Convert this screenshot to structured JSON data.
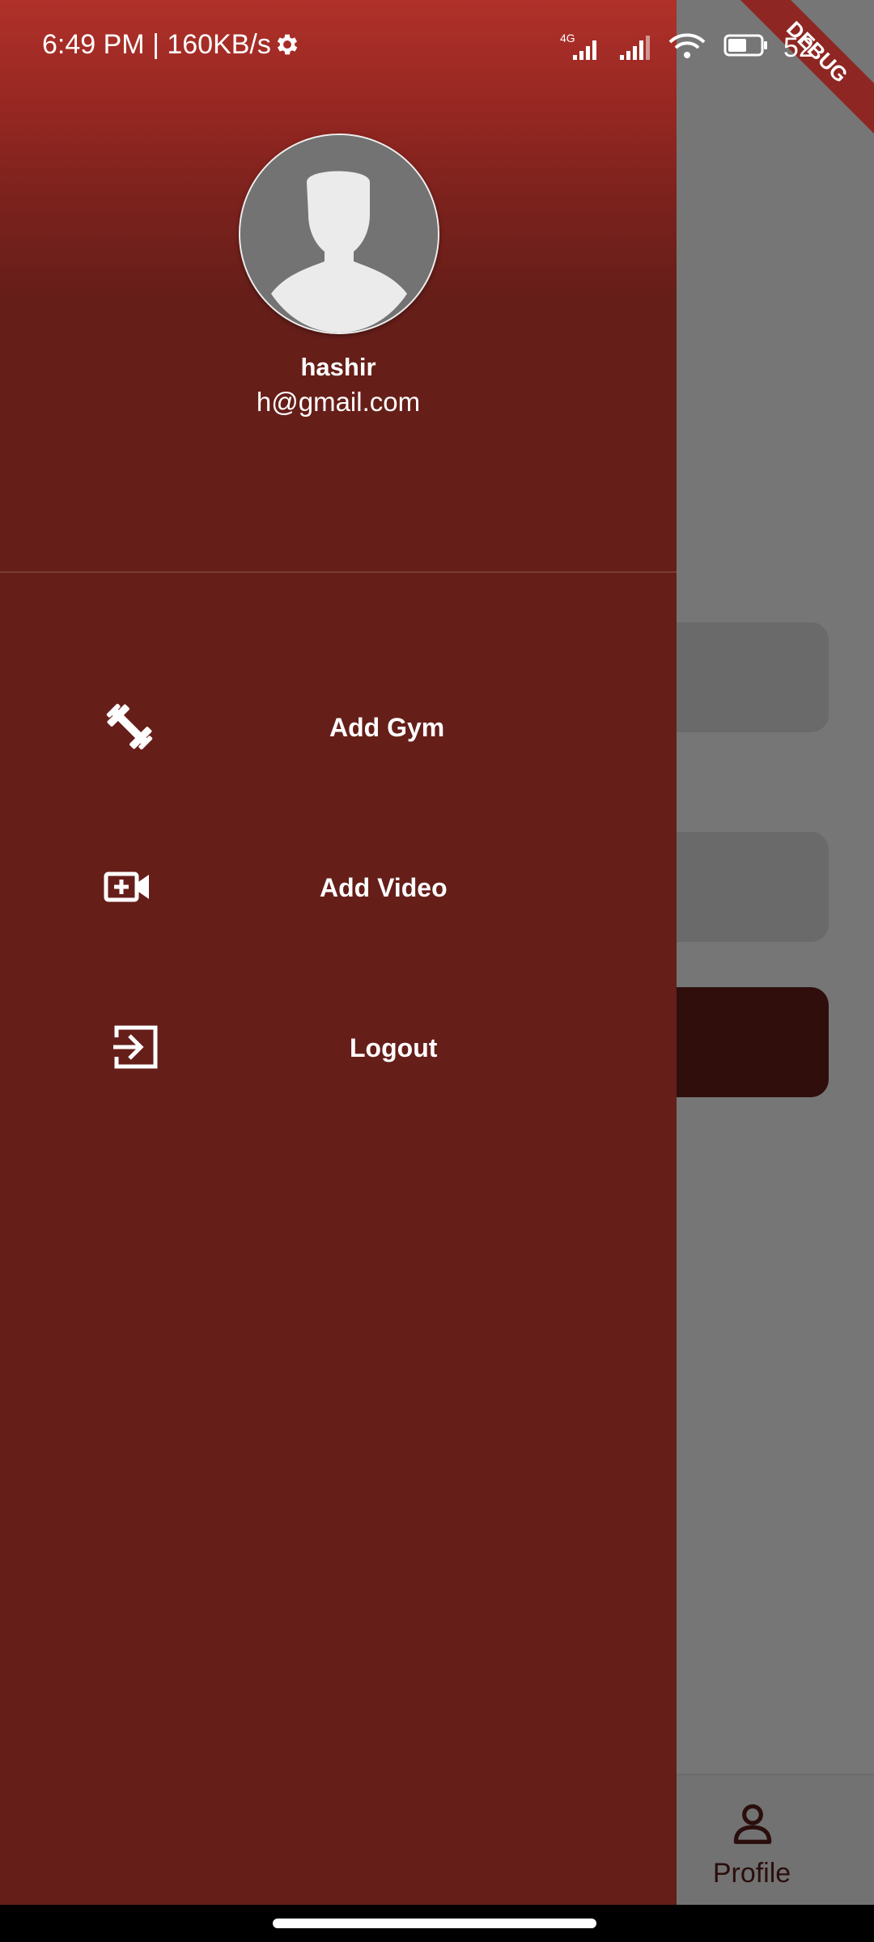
{
  "status_bar": {
    "time_speed": "6:49 PM | 160KB/s",
    "network_label": "4G",
    "battery_text": "52"
  },
  "debug_banner": "DEBUG",
  "drawer": {
    "user": {
      "name": "hashir",
      "email": "h@gmail.com"
    },
    "items": [
      {
        "label": "Add Gym",
        "icon": "dumbbell-icon"
      },
      {
        "label": "Add Video",
        "icon": "video-add-icon"
      },
      {
        "label": "Logout",
        "icon": "logout-icon"
      }
    ]
  },
  "background": {
    "bottom_nav": {
      "profile_label": "Profile"
    }
  },
  "colors": {
    "drawer": "#661e19",
    "header_top": "#b0312a",
    "scrim": "#767676",
    "button_dark": "#2f0e0c"
  }
}
